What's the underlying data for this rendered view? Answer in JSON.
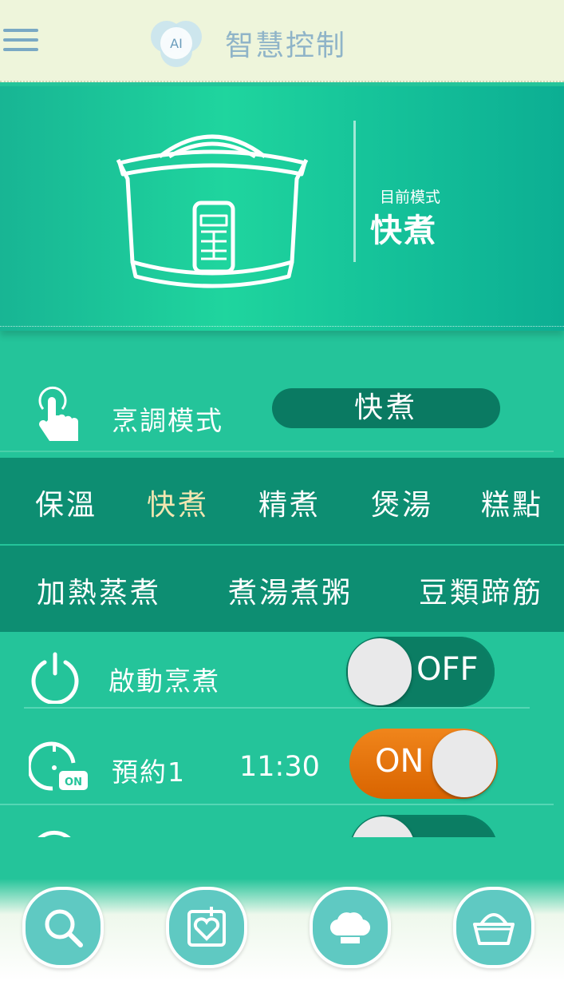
{
  "header": {
    "title": "智慧控制",
    "logo_text": "AI"
  },
  "hero": {
    "current_mode_label": "目前模式",
    "current_mode_value": "快煮"
  },
  "cooking_mode": {
    "label": "烹調模式",
    "selected": "快煮"
  },
  "mode_options_row1": [
    {
      "label": "保溫",
      "active": false
    },
    {
      "label": "快煮",
      "active": true
    },
    {
      "label": "精煮",
      "active": false
    },
    {
      "label": "煲湯",
      "active": false
    },
    {
      "label": "糕點",
      "active": false
    }
  ],
  "mode_options_row2": [
    {
      "label": "加熱蒸煮"
    },
    {
      "label": "煮湯煮粥"
    },
    {
      "label": "豆類蹄筋"
    }
  ],
  "start_cooking": {
    "label": "啟動烹煮",
    "toggle_text": "OFF",
    "state": "off"
  },
  "reservation1": {
    "label": "預約1",
    "time": "11:30",
    "toggle_text": "ON",
    "state": "on",
    "badge": "ON"
  },
  "footer": {
    "buttons": [
      "search-icon",
      "heart-card-icon",
      "chef-hat-icon",
      "basket-icon"
    ]
  },
  "colors": {
    "accent": "#24c49a",
    "dark": "#0d8e72",
    "on": "#e8790e",
    "active_text": "#f2e6b1"
  }
}
